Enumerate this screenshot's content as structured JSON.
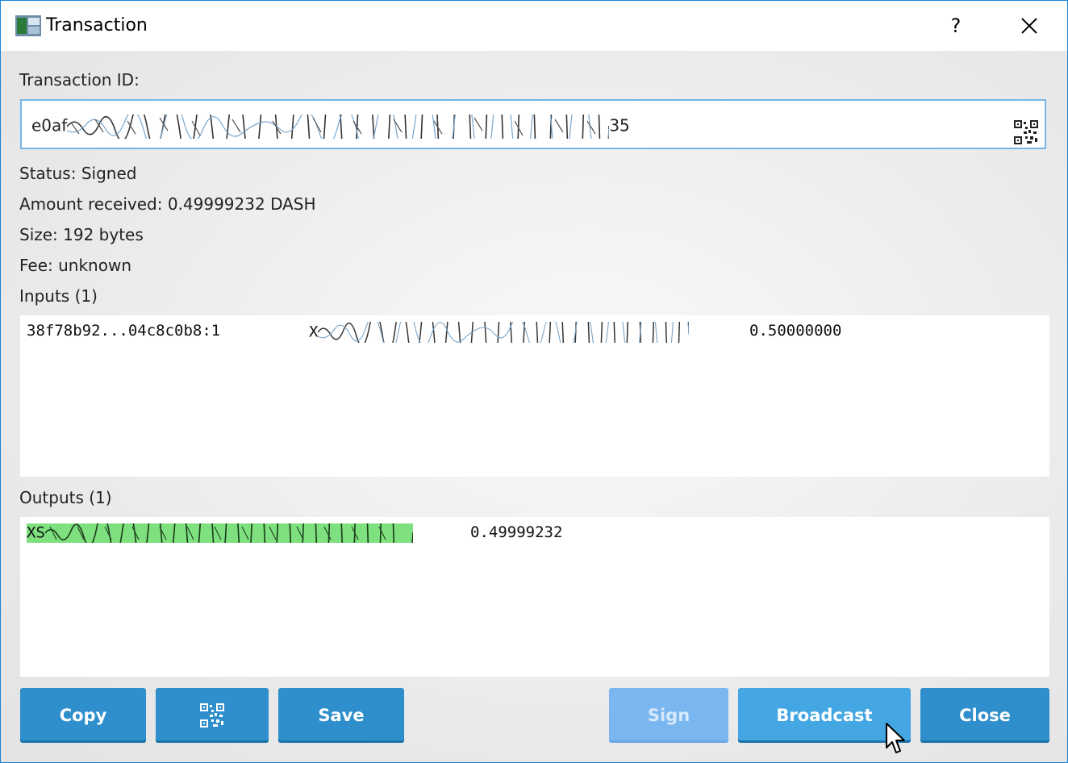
{
  "window": {
    "title": "Transaction",
    "help_glyph": "?",
    "close_glyph": "✕"
  },
  "txid": {
    "label": "Transaction ID:",
    "prefix": "e0af",
    "suffix": "35",
    "qr_icon": "qr-code-icon"
  },
  "info": {
    "status": "Status: Signed",
    "amount": "Amount received: 0.49999232 DASH",
    "size": "Size: 192 bytes",
    "fee": "Fee: unknown"
  },
  "inputs": {
    "label": "Inputs (1)",
    "rows": [
      {
        "outpoint": "38f78b92...04c8c0b8:1",
        "address_prefix": "X",
        "amount": "0.50000000"
      }
    ]
  },
  "outputs": {
    "label": "Outputs (1)",
    "rows": [
      {
        "address_prefix": "XS",
        "amount": "0.49999232"
      }
    ],
    "highlight_color": "#7ee07e"
  },
  "buttons": {
    "copy": "Copy",
    "qr": "qr-code-icon",
    "save": "Save",
    "sign": "Sign",
    "broadcast": "Broadcast",
    "close": "Close"
  },
  "colors": {
    "button": "#2f8fcd",
    "button_disabled": "#7ab7f0",
    "window_border": "#1883d7"
  }
}
